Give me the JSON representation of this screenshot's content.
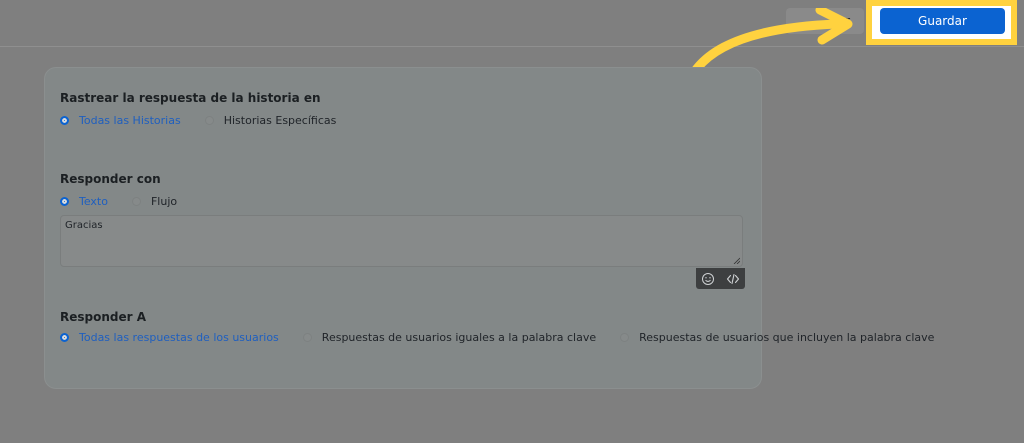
{
  "header": {
    "cancel_label": "lar",
    "save_label": "Guardar"
  },
  "colors": {
    "overlay": "#7f7f7f",
    "primary": "#0b63d1",
    "highlight": "#ffd23f"
  },
  "track": {
    "title": "Rastrear la respuesta de la historia en",
    "options": [
      {
        "label": "Todas las Historias",
        "selected": true
      },
      {
        "label": "Historias Específicas",
        "selected": false
      }
    ]
  },
  "respond_with": {
    "title": "Responder con",
    "options": [
      {
        "label": "Texto",
        "selected": true
      },
      {
        "label": "Flujo",
        "selected": false
      }
    ],
    "text_value": "Gracias",
    "tools": [
      "emoji-icon",
      "code-icon"
    ]
  },
  "respond_to": {
    "title": "Responder A",
    "options": [
      {
        "label": "Todas las respuestas de los usuarios",
        "selected": true
      },
      {
        "label": "Respuestas de usuarios iguales a la palabra clave",
        "selected": false
      },
      {
        "label": "Respuestas de usuarios que incluyen la palabra clave",
        "selected": false
      }
    ]
  }
}
